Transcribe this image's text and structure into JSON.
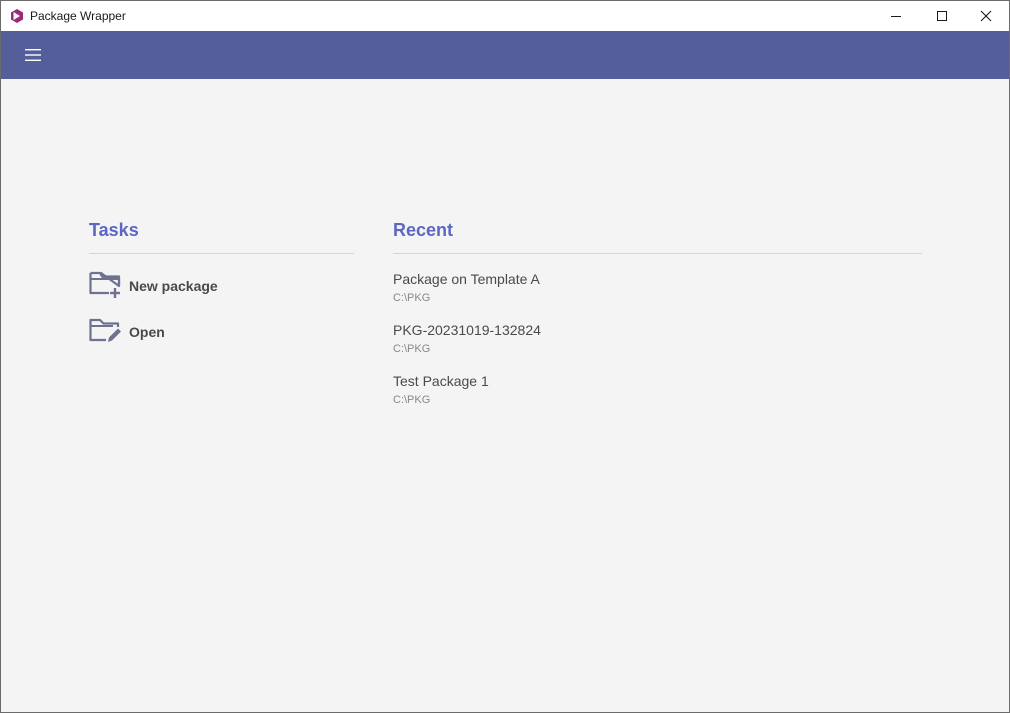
{
  "window": {
    "title": "Package Wrapper",
    "icon": "package-wrapper-logo",
    "controls": {
      "minimize_icon": "minimize-icon",
      "maximize_icon": "maximize-icon",
      "close_icon": "close-icon"
    }
  },
  "appbar": {
    "menu_icon": "hamburger-menu-icon",
    "color": "#535e9b"
  },
  "tasks": {
    "title": "Tasks",
    "items": [
      {
        "label": "New package",
        "icon": "folder-add-icon"
      },
      {
        "label": "Open",
        "icon": "folder-edit-icon"
      }
    ]
  },
  "recent": {
    "title": "Recent",
    "items": [
      {
        "name": "Package on Template A",
        "path": "C:\\PKG"
      },
      {
        "name": "PKG-20231019-132824",
        "path": "C:\\PKG"
      },
      {
        "name": "Test Package 1",
        "path": "C:\\PKG"
      }
    ]
  },
  "colors": {
    "accent": "#5c67c4",
    "header": "#535e9b",
    "background": "#f4f4f4",
    "logo": "#9c2a7a"
  }
}
